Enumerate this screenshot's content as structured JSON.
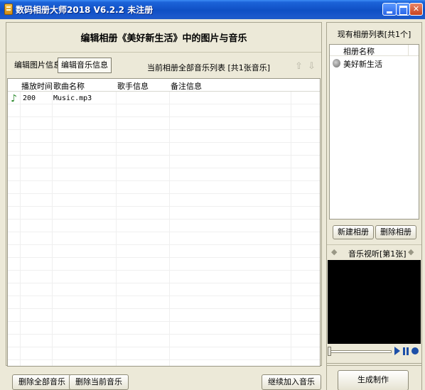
{
  "window": {
    "title": "数码相册大师2018 V6.2.2  未注册",
    "controls": [
      "minimize",
      "maximize",
      "close"
    ]
  },
  "editor": {
    "header_title": "编辑相册《美好新生活》中的图片与音乐",
    "tabs": [
      {
        "label": "编辑图片信息",
        "active": false
      },
      {
        "label": "编辑音乐信息",
        "active": true
      }
    ],
    "list_title": "当前相册全部音乐列表 [共1张音乐]",
    "music_table": {
      "columns": [
        "播放时间",
        "歌曲名称",
        "歌手信息",
        "备注信息"
      ],
      "rows": [
        {
          "time": "200",
          "name": "Music.mp3",
          "artist": "",
          "note": ""
        }
      ]
    },
    "buttons": {
      "delete_all": "删除全部音乐",
      "delete_current": "删除当前音乐",
      "continue_add": "继续加入音乐"
    }
  },
  "albums": {
    "title": "现有相册列表[共1个]",
    "column": "相册名称",
    "items": [
      "美好新生活"
    ],
    "new_button": "新建相册",
    "delete_button": "删除相册"
  },
  "preview": {
    "label": "音乐视听[第1张]"
  },
  "generate_button": "生成制作",
  "colors": {
    "titlebar": "#0F4FC4",
    "window_bg": "#ECE9D8",
    "preview_bg": "#000000",
    "player_controls": "#1C4FA8"
  }
}
